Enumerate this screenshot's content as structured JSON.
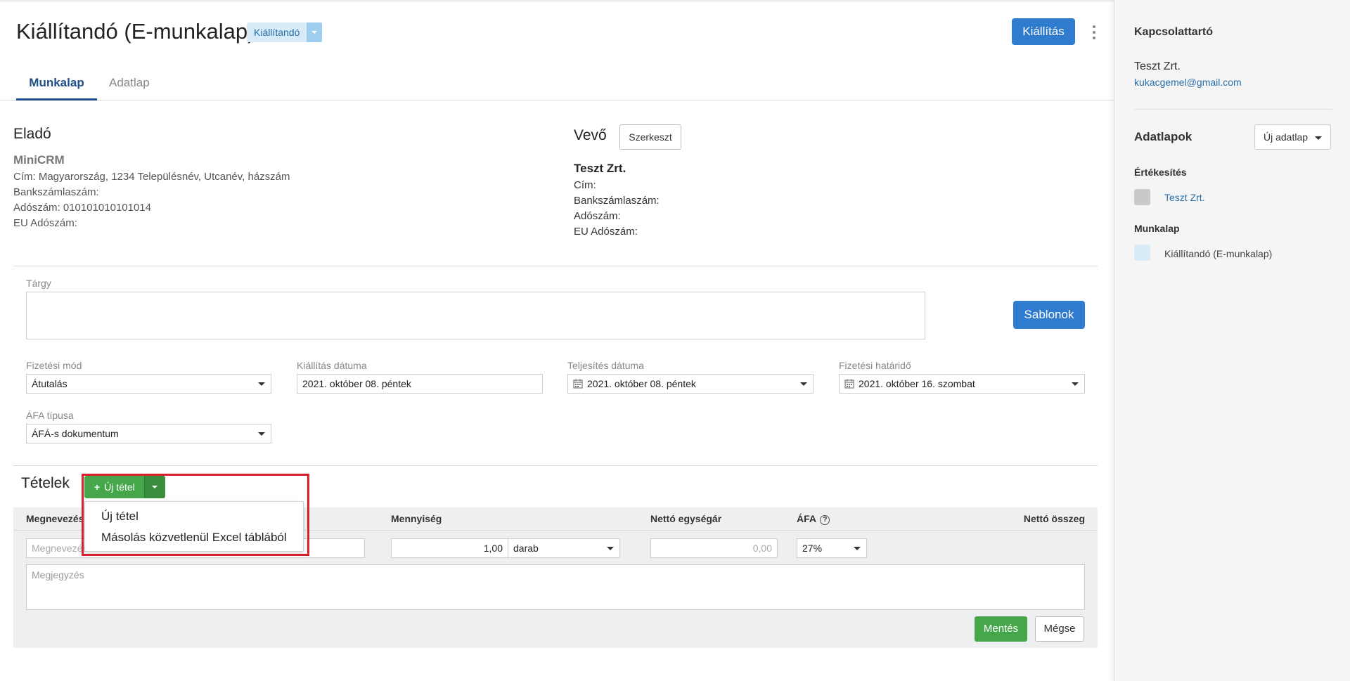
{
  "header": {
    "title": "Kiállítandó (E-munkalap)",
    "status_tag": "Kiállítandó",
    "primary_button": "Kiállítás"
  },
  "tabs": [
    {
      "label": "Munkalap",
      "active": true
    },
    {
      "label": "Adatlap",
      "active": false
    }
  ],
  "seller": {
    "heading": "Eladó",
    "company": "MiniCRM",
    "address": "Cím: Magyarország, 1234 Településnév, Utcanév, házszám",
    "bank": "Bankszámlaszám:",
    "tax": "Adószám: 010101010101014",
    "eu_tax": "EU Adószám:"
  },
  "buyer": {
    "heading": "Vevő",
    "edit_button": "Szerkeszt",
    "company": "Teszt Zrt.",
    "address": "Cím:",
    "bank": "Bankszámlaszám:",
    "tax": "Adószám:",
    "eu_tax": "EU Adószám:"
  },
  "subject": {
    "label": "Tárgy",
    "value": "",
    "templates_button": "Sablonok"
  },
  "fields": {
    "payment_method": {
      "label": "Fizetési mód",
      "value": "Átutalás"
    },
    "issue_date": {
      "label": "Kiállítás dátuma",
      "value": "2021. október 08. péntek"
    },
    "fulfillment_date": {
      "label": "Teljesítés dátuma",
      "value": "2021. október 08. péntek"
    },
    "payment_deadline": {
      "label": "Fizetési határidő",
      "value": "2021. október 16. szombat"
    },
    "vat_type": {
      "label": "ÁFA típusa",
      "value": "ÁFÁ-s dokumentum"
    }
  },
  "items": {
    "title": "Tételek",
    "new_item_button": "Új tétel",
    "dropdown": [
      "Új tétel",
      "Másolás közvetlenül Excel táblából"
    ],
    "columns": {
      "name": "Megnevezés",
      "quantity": "Mennyiség",
      "unit_price": "Nettó egységár",
      "vat": "ÁFA",
      "net_total": "Nettó összeg"
    },
    "row": {
      "name_placeholder": "Megnevezés",
      "quantity": "1,00",
      "unit": "darab",
      "unit_price_placeholder": "0,00",
      "vat": "27%"
    },
    "note_placeholder": "Megjegyzés",
    "save_button": "Mentés",
    "cancel_button": "Mégse"
  },
  "sidebar": {
    "contact_title": "Kapcsolattartó",
    "contact_name": "Teszt Zrt.",
    "contact_email": "kukacgemel@gmail.com",
    "sheets_title": "Adatlapok",
    "new_sheet_button": "Új adatlap",
    "sales_label": "Értékesítés",
    "sales_item": "Teszt Zrt.",
    "worksheet_label": "Munkalap",
    "worksheet_item": "Kiállítandó (E-munkalap)"
  },
  "colors": {
    "primary": "#2f7ccf",
    "success": "#46a64a",
    "highlight": "#d9202a",
    "status_tag_bg": "#d7ebf8"
  }
}
